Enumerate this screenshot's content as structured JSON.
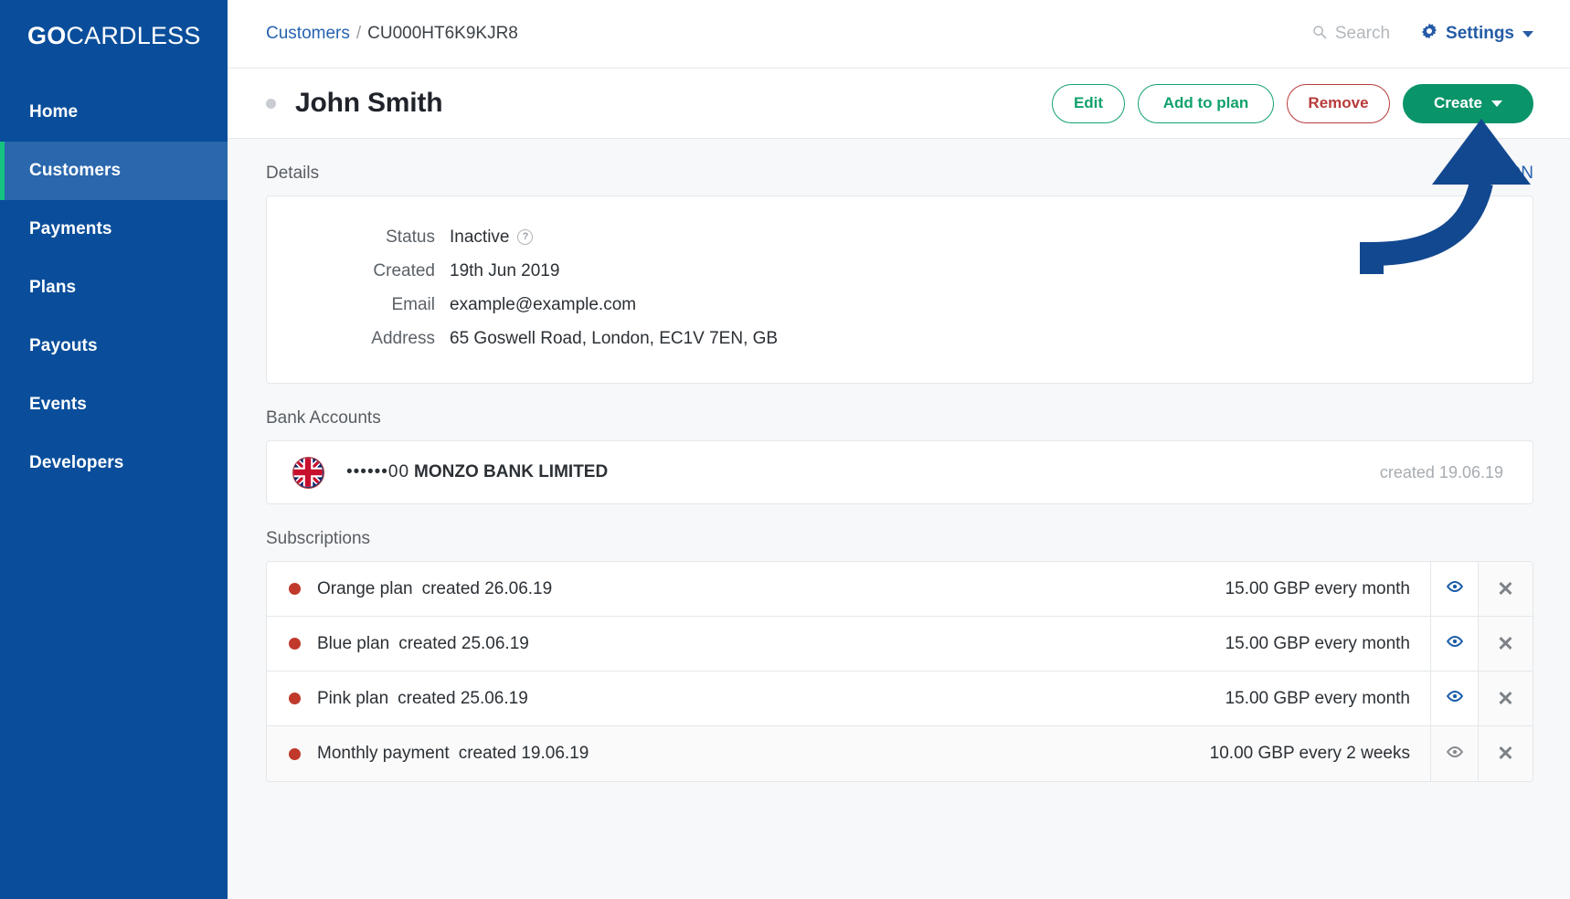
{
  "sidebar": {
    "brand_go": "GO",
    "brand_rest": "CARDLESS",
    "items": [
      {
        "label": "Home",
        "active": false
      },
      {
        "label": "Customers",
        "active": true
      },
      {
        "label": "Payments",
        "active": false
      },
      {
        "label": "Plans",
        "active": false
      },
      {
        "label": "Payouts",
        "active": false
      },
      {
        "label": "Events",
        "active": false
      },
      {
        "label": "Developers",
        "active": false
      }
    ],
    "bg_color": "#0a4e9b",
    "active_bg_color": "#2a67ad",
    "active_accent_color": "#13c37f"
  },
  "topbar": {
    "breadcrumb_root": "Customers",
    "breadcrumb_sep": "/",
    "breadcrumb_current": "CU000HT6K9KJR8",
    "search_placeholder": "Search",
    "search_icon": "search-icon",
    "settings_label": "Settings",
    "settings_icon": "gear-icon",
    "settings_caret_icon": "chevron-down-icon"
  },
  "header": {
    "status_dot": "inactive-status-dot",
    "customer_name": "John Smith",
    "buttons": {
      "edit": "Edit",
      "add_to_plan": "Add to plan",
      "remove": "Remove",
      "create": "Create",
      "create_caret_icon": "chevron-down-icon"
    },
    "colors": {
      "green": "#12a16c",
      "red": "#b73b3b",
      "create_bg": "#0a9469"
    }
  },
  "details": {
    "section_title": "Details",
    "json_link": "JSON",
    "rows": [
      {
        "label": "Status",
        "value": "Inactive",
        "help_icon": "question-mark-icon"
      },
      {
        "label": "Created",
        "value": "19th Jun 2019"
      },
      {
        "label": "Email",
        "value": "example@example.com"
      },
      {
        "label": "Address",
        "value": "65 Goswell Road, London, EC1V 7EN, GB"
      }
    ]
  },
  "bank_accounts": {
    "section_title": "Bank Accounts",
    "items": [
      {
        "flag_icon": "uk-flag-icon",
        "masked_number": "••••••00",
        "bank_name": "MONZO BANK LIMITED",
        "created": "created 19.06.19"
      }
    ]
  },
  "subscriptions": {
    "section_title": "Subscriptions",
    "rows": [
      {
        "dot_color": "#c0392b",
        "name": "Orange plan",
        "created": "created 26.06.19",
        "amount": "15.00 GBP every month",
        "view_icon": "eye-icon",
        "cancel_icon": "close-x-icon",
        "faded": false
      },
      {
        "dot_color": "#c0392b",
        "name": "Blue plan",
        "created": "created 25.06.19",
        "amount": "15.00 GBP every month",
        "view_icon": "eye-icon",
        "cancel_icon": "close-x-icon",
        "faded": false
      },
      {
        "dot_color": "#c0392b",
        "name": "Pink plan",
        "created": "created 25.06.19",
        "amount": "15.00 GBP every month",
        "view_icon": "eye-icon",
        "cancel_icon": "close-x-icon",
        "faded": false
      },
      {
        "dot_color": "#c0392b",
        "name": "Monthly payment",
        "created": "created 19.06.19",
        "amount": "10.00 GBP every 2 weeks",
        "view_icon": "eye-icon",
        "cancel_icon": "close-x-icon",
        "faded": true
      }
    ]
  },
  "annotation": {
    "arrow_icon": "curved-up-arrow-annotation",
    "arrow_color": "#12488f",
    "points_to": "Remove"
  }
}
